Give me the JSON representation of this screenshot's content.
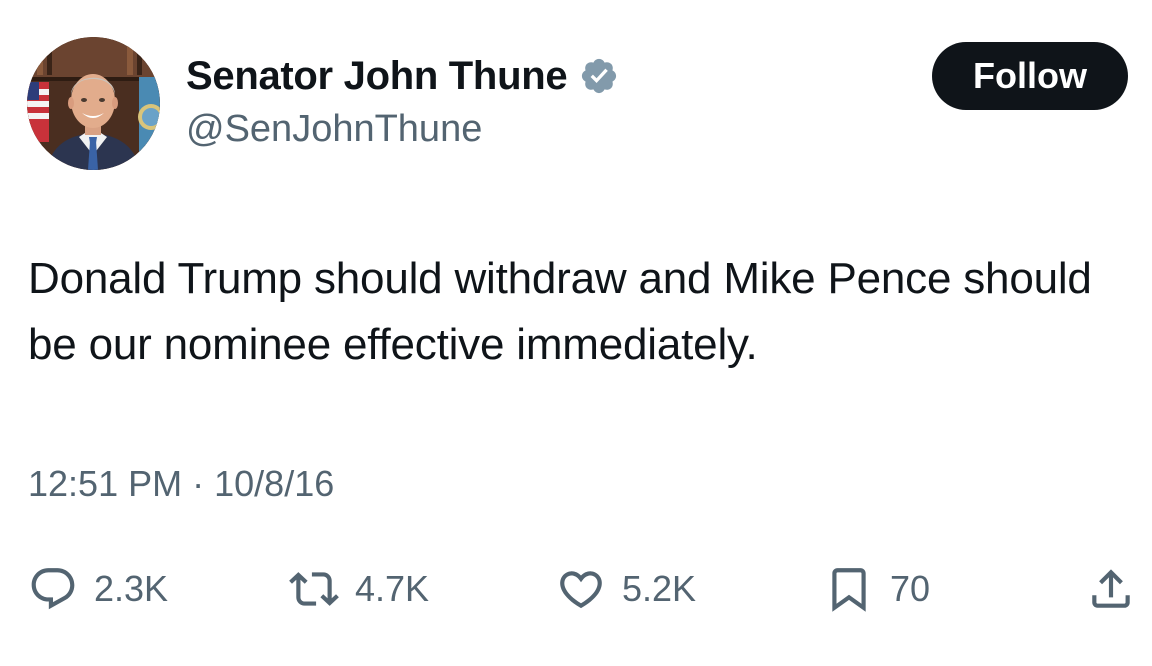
{
  "tweet": {
    "author": {
      "display_name": "Senator John Thune",
      "handle": "@SenJohnThune",
      "verified": true,
      "verified_color": "#829aab"
    },
    "follow_label": "Follow",
    "text": "Donald Trump should withdraw and Mike Pence should be our nominee effective immediately.",
    "time": "12:51 PM",
    "separator": "·",
    "date": "10/8/16",
    "metrics": {
      "replies": "2.3K",
      "reposts": "4.7K",
      "likes": "5.2K",
      "bookmarks": "70"
    }
  },
  "colors": {
    "text_primary": "#0f1419",
    "text_secondary": "#536471",
    "button_bg": "#0f1419",
    "button_text": "#ffffff"
  },
  "icons": {
    "reply": "reply-icon",
    "repost": "repost-icon",
    "like": "like-icon",
    "bookmark": "bookmark-icon",
    "share": "share-icon",
    "verified": "verified-badge-icon"
  }
}
